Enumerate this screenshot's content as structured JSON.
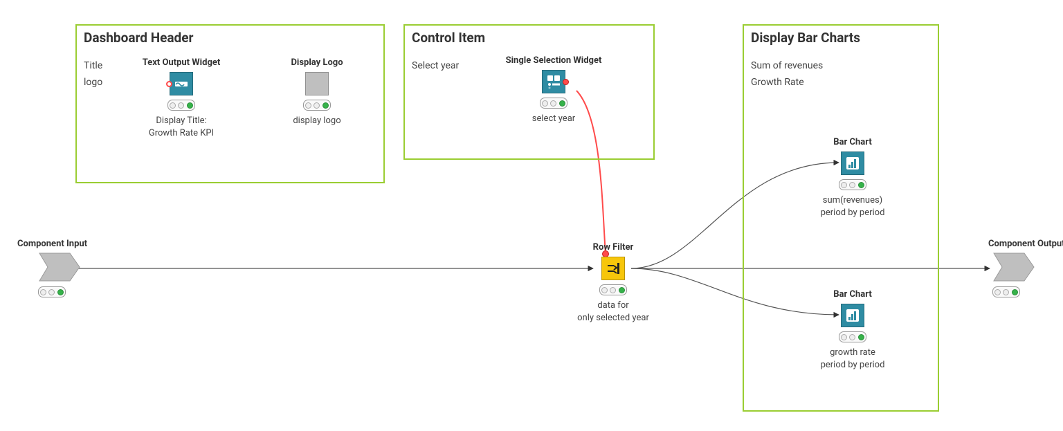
{
  "groups": {
    "header": {
      "title": "Dashboard Header",
      "sub1": "Title",
      "sub2": "logo"
    },
    "control": {
      "title": "Control Item",
      "sub1": "Select year"
    },
    "charts": {
      "title": "Display Bar Charts",
      "sub1": "Sum of revenues",
      "sub2": "Growth Rate"
    }
  },
  "nodes": {
    "textOutput": {
      "title": "Text Output Widget",
      "caption1": "Display Title:",
      "caption2": "Growth Rate KPI"
    },
    "displayLogo": {
      "title": "Display Logo",
      "caption1": "display logo"
    },
    "selection": {
      "title": "Single Selection Widget",
      "caption1": "select year"
    },
    "rowFilter": {
      "title": "Row Filter",
      "caption1": "data for",
      "caption2": "only selected year"
    },
    "bar1": {
      "title": "Bar Chart",
      "caption1": "sum(revenues)",
      "caption2": "period by period"
    },
    "bar2": {
      "title": "Bar Chart",
      "caption1": "growth rate",
      "caption2": "period by period"
    },
    "input": {
      "title": "Component Input"
    },
    "output": {
      "title": "Component Output"
    }
  }
}
